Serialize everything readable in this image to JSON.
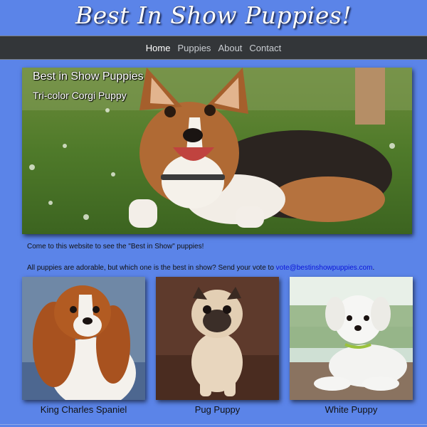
{
  "header": {
    "title": "Best In Show Puppies!"
  },
  "nav": {
    "items": [
      {
        "label": "Home",
        "active": true
      },
      {
        "label": "Puppies",
        "active": false
      },
      {
        "label": "About",
        "active": false
      },
      {
        "label": "Contact",
        "active": false
      }
    ]
  },
  "hero": {
    "title": "Best in Show Puppies",
    "subtitle": "Tri-color Corgi Puppy"
  },
  "intro": {
    "line1": "Come to this website to see the \"Best in Show\" puppies!",
    "line2_prefix": "All puppies are adorable, but which one is the best in show? Send your vote to ",
    "email": "vote@bestinshowpuppies.com",
    "line2_suffix": "."
  },
  "gallery": [
    {
      "caption": "King Charles Spaniel"
    },
    {
      "caption": "Pug Puppy"
    },
    {
      "caption": "White Puppy"
    }
  ],
  "colors": {
    "page_background": "#5b84e8",
    "nav_background": "#333639",
    "link": "#0a14d9"
  }
}
